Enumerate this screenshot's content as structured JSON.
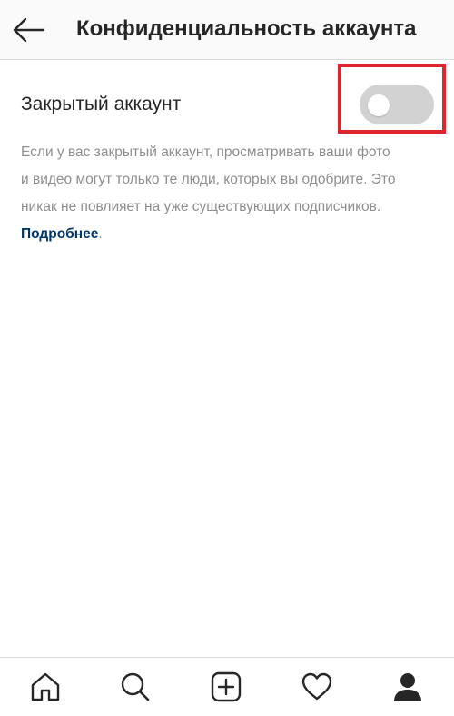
{
  "header": {
    "title": "Конфиденциальность аккаунта",
    "back_icon": "arrow-left-icon"
  },
  "private_account": {
    "label": "Закрытый аккаунт",
    "toggle_on": false,
    "highlight_color": "#e0242c"
  },
  "description": {
    "line1": "Если у вас закрытый аккаунт, просматривать ваши фото",
    "line2": "и видео могут только те люди, которых вы одобрите. Это",
    "line3": "никак не повлияет на уже существующих подписчиков.",
    "link_text": "Подробнее",
    "trailing": "."
  },
  "tabbar": {
    "items": [
      {
        "icon": "home-icon"
      },
      {
        "icon": "search-icon"
      },
      {
        "icon": "add-post-icon"
      },
      {
        "icon": "heart-icon"
      },
      {
        "icon": "profile-icon"
      }
    ]
  },
  "colors": {
    "text": "#262626",
    "secondary_text": "#8e8e8e",
    "link": "#00376b",
    "toggle_off": "#d2d2d2"
  }
}
